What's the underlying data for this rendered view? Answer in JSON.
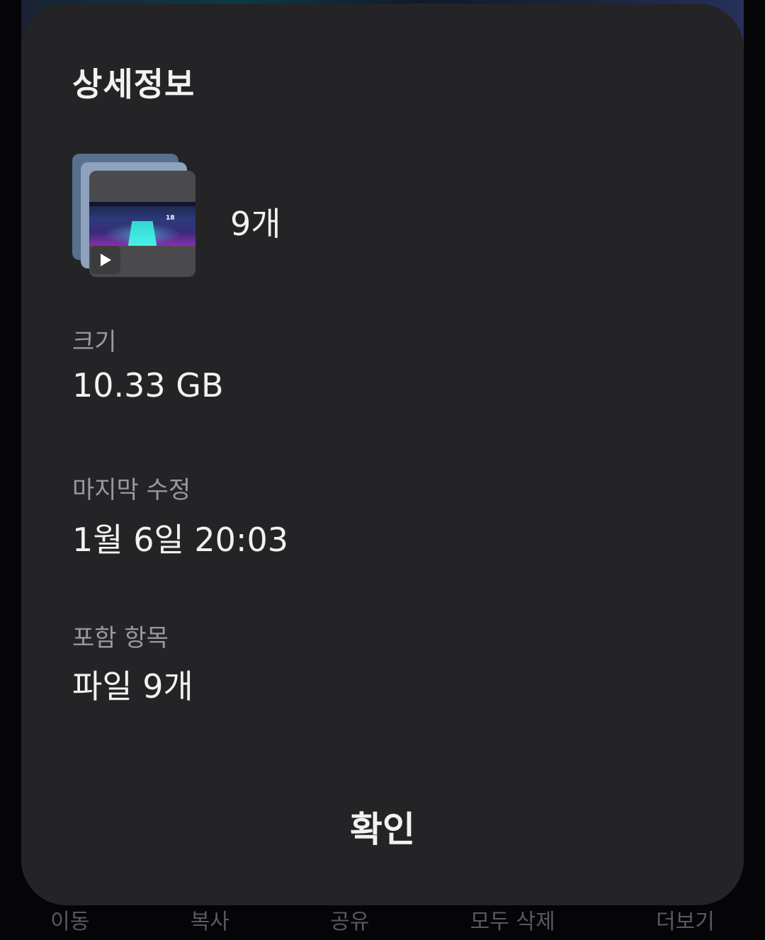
{
  "dialog": {
    "title": "상세정보",
    "item_count": "9개",
    "size": {
      "label": "크기",
      "value": "10.33 GB"
    },
    "modified": {
      "label": "마지막 수정",
      "value": "1월 6일 20:03"
    },
    "contents": {
      "label": "포함 항목",
      "value": "파일 9개"
    },
    "confirm_label": "확인",
    "thumbnail": {
      "type": "video",
      "icon": "play-icon",
      "overlay_text": "18"
    }
  },
  "bottom_bar": {
    "items": [
      "이동",
      "복사",
      "공유",
      "모두 삭제",
      "더보기"
    ]
  },
  "colors": {
    "sheet_background": "#242426",
    "primary_text": "#f2f2f2",
    "secondary_text": "#9a9a9c"
  }
}
